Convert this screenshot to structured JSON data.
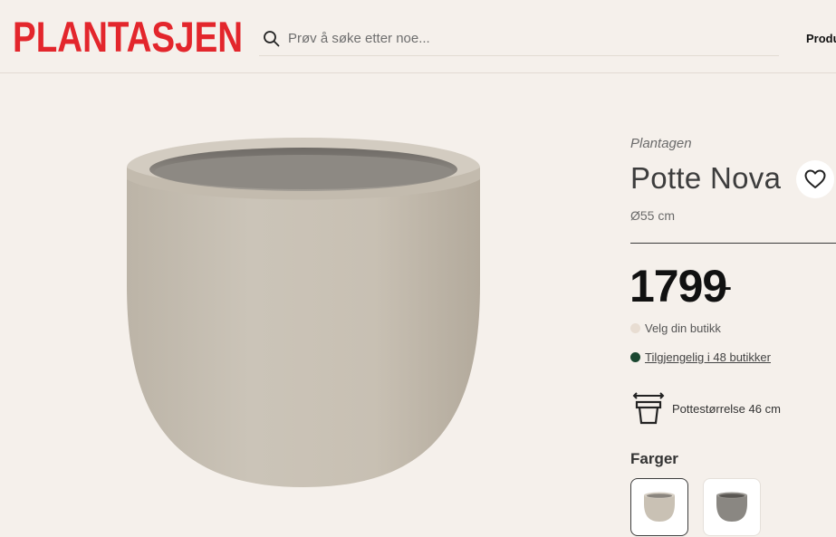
{
  "header": {
    "logo_text": "PLANTASJEN",
    "search_placeholder": "Prøv å søke etter noe...",
    "nav_link": "Produ"
  },
  "product": {
    "brand": "Plantagen",
    "title": "Potte Nova",
    "size": "Ø55 cm",
    "price": "1799",
    "price_suffix": ",-",
    "store_select": "Velg din butikk",
    "availability": "Tilgjengelig i 48 butikker",
    "pot_size": "Pottestørrelse 46 cm",
    "colors_label": "Farger",
    "swatches": [
      {
        "name": "beige",
        "color": "#c9c1b4",
        "selected": true
      },
      {
        "name": "grey",
        "color": "#8a8782",
        "selected": false
      }
    ]
  },
  "colors": {
    "logo_red": "#e3262c",
    "background": "#f5f0eb",
    "stock_green": "#1a4730",
    "pot_beige": "#c9c2b6"
  },
  "icons": [
    "search-icon",
    "heart-icon",
    "pot-size-icon"
  ]
}
